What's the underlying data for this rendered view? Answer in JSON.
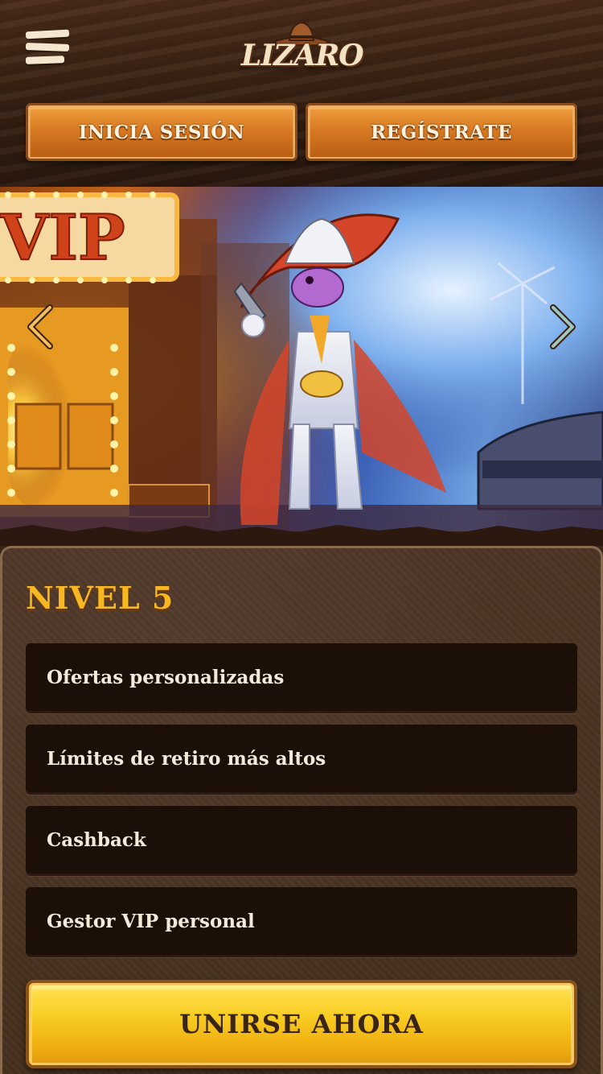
{
  "header": {
    "logo_text": "LIZARO",
    "login_label": "INICIA SESIÓN",
    "register_label": "REGÍSTRATE"
  },
  "hero": {
    "sign_text": "VIP"
  },
  "vip": {
    "level_title": "NIVEL 5",
    "benefits": [
      "Ofertas personalizadas",
      "Límites de retiro más altos",
      "Cashback",
      "Gestor VIP personal"
    ],
    "join_label": "UNIRSE AHORA"
  },
  "colors": {
    "accent_orange": "#d87a22",
    "accent_gold": "#f7b824",
    "join_yellow": "#f8cd22",
    "panel_brown": "#46301f",
    "benefit_bg": "#1c0f08"
  }
}
